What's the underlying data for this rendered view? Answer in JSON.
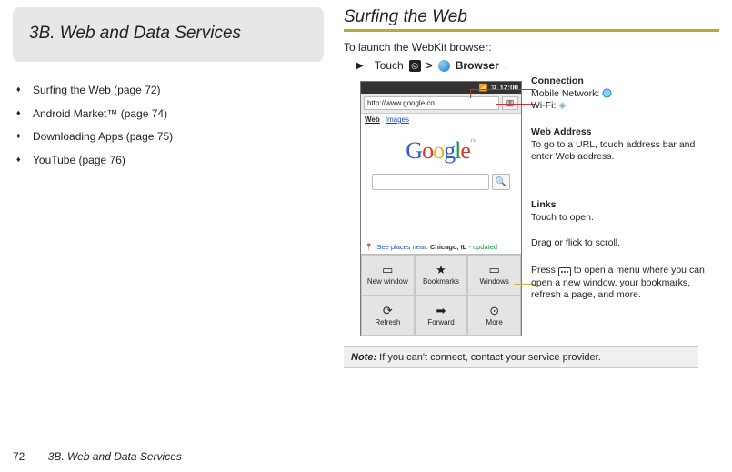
{
  "left": {
    "tab_title": "3B.  Web and Data Services",
    "toc": [
      "Surfing the Web (page 72)",
      "Android Market™ (page 74)",
      "Downloading Apps (page 75)",
      "YouTube (page 76)"
    ]
  },
  "right": {
    "title": "Surfing the Web",
    "intro": "To launch the WebKit browser:",
    "step_touch": "Touch",
    "step_gt": ">",
    "step_browser": "Browser",
    "step_dot": "."
  },
  "phone": {
    "status_time": "12:00",
    "url": "http://www.google.co...",
    "tabs": {
      "web": "Web",
      "images": "Images"
    },
    "search_icon": "🔍",
    "places_prefix": "See places near:",
    "places_city": "Chicago, IL",
    "places_sep": "-",
    "places_upd": "updated",
    "menu": {
      "new_window": "New window",
      "bookmarks": "Bookmarks",
      "windows": "Windows",
      "refresh": "Refresh",
      "forward": "Forward",
      "more": "More"
    }
  },
  "annotations": {
    "connection_title": "Connection",
    "connection_mobile": "Mobile Network:",
    "connection_wifi": "Wi-Fi:",
    "webaddr_title": "Web Address",
    "webaddr_body": "To go to a URL, touch address bar and enter Web address.",
    "links_title": "Links",
    "links_body": "Touch to open.",
    "drag": "Drag or flick to scroll.",
    "menu_body_1": "Press ",
    "menu_body_2": " to open a menu where you can open a new window, your bookmarks, refresh a page, and more."
  },
  "note": {
    "label": "Note:",
    "body": "  If you can't connect, contact your service provider."
  },
  "footer": {
    "page": "72",
    "crumb": "3B. Web and Data Services"
  }
}
